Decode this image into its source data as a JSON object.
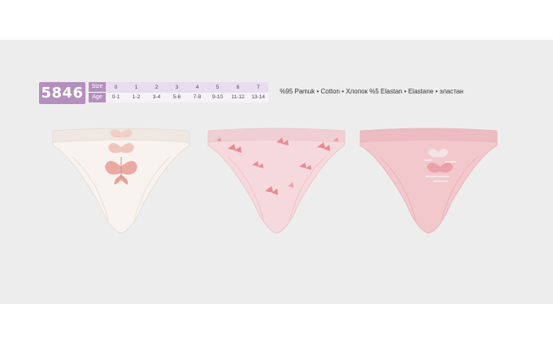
{
  "model": {
    "code": "5846"
  },
  "size_table": {
    "row_labels": {
      "size": "Size",
      "age": "Age"
    },
    "sizes": [
      "0",
      "1",
      "2",
      "3",
      "4",
      "5",
      "6",
      "7"
    ],
    "ages": [
      "0-1",
      "1-2",
      "3-4",
      "5-6",
      "7-8",
      "9-10",
      "11-12",
      "13-14"
    ]
  },
  "fabric": {
    "composition": "%95 Pamuk • Cotton • Хлопок %5 Elastan • Elastane • эластан"
  },
  "products": [
    {
      "name": "ivory-briefs-butterfly-stack",
      "color": "#f8f3ee",
      "trim": "#efe8e2",
      "print": "butterfly-stack"
    },
    {
      "name": "light-pink-briefs-butterfly-allover",
      "color": "#f6d9dd",
      "trim": "#f0cfd4",
      "print": "butterfly-allover"
    },
    {
      "name": "pink-briefs-butterfly-text",
      "color": "#f3c8cd",
      "trim": "#ecbcc2",
      "print": "butterfly-text"
    }
  ],
  "colors": {
    "accent": "#b48fbe",
    "background_band": "#eeedee"
  }
}
